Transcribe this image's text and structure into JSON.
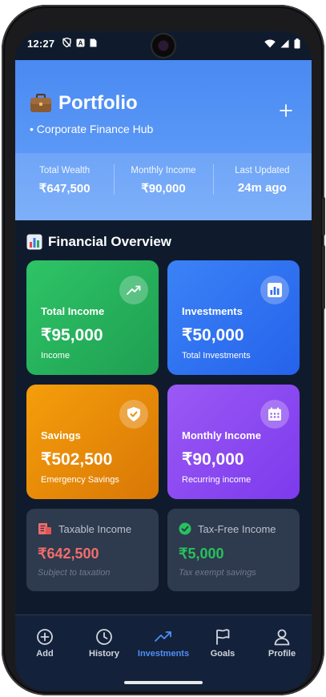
{
  "status_bar": {
    "time": "12:27"
  },
  "header": {
    "title": "Portfolio",
    "subtitle": "• Corporate Finance Hub",
    "stats": [
      {
        "label": "Total Wealth",
        "value": "₹647,500"
      },
      {
        "label": "Monthly Income",
        "value": "₹90,000"
      },
      {
        "label": "Last Updated",
        "value": "24m ago"
      }
    ]
  },
  "overview": {
    "title": "Financial Overview",
    "cards": [
      {
        "title": "Total Income",
        "value": "₹95,000",
        "subtitle": "Income",
        "icon": "trending-up-icon",
        "color": "#2ec466"
      },
      {
        "title": "Investments",
        "value": "₹50,000",
        "subtitle": "Total Investments",
        "icon": "bar-chart-icon",
        "color": "#3b82f6"
      },
      {
        "title": "Savings",
        "value": "₹502,500",
        "subtitle": "Emergency Savings",
        "icon": "shield-check-icon",
        "color": "#f59e0b"
      },
      {
        "title": "Monthly Income",
        "value": "₹90,000",
        "subtitle": "Recurring income",
        "icon": "calendar-icon",
        "color": "#9b59f5"
      }
    ],
    "tax": [
      {
        "title": "Taxable Income",
        "value": "₹642,500",
        "note": "Subject to taxation",
        "icon": "receipt-icon",
        "color": "#f26d6d"
      },
      {
        "title": "Tax-Free Income",
        "value": "₹5,000",
        "note": "Tax exempt savings",
        "icon": "check-circle-icon",
        "color": "#26c25e"
      }
    ]
  },
  "nav": {
    "items": [
      {
        "label": "Add",
        "icon": "plus-circle-icon"
      },
      {
        "label": "History",
        "icon": "clock-icon"
      },
      {
        "label": "Investments",
        "icon": "trending-up-icon",
        "active": true
      },
      {
        "label": "Goals",
        "icon": "flag-icon"
      },
      {
        "label": "Profile",
        "icon": "user-icon"
      }
    ]
  }
}
